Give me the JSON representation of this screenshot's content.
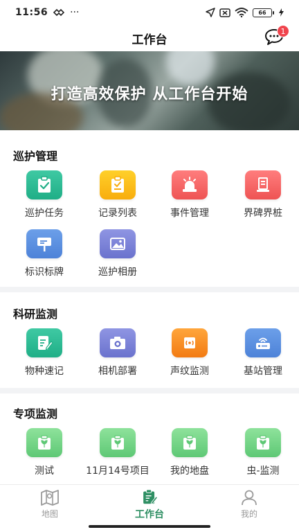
{
  "status_bar": {
    "time": "11:56",
    "dots": "···",
    "battery": "66"
  },
  "header": {
    "title": "工作台",
    "badge": "1"
  },
  "banner": {
    "text": "打造高效保护 从工作台开始"
  },
  "sections": [
    {
      "title": "巡护管理",
      "items": [
        {
          "label": "巡护任务",
          "icon": "clipboard-check-icon",
          "color": "#1fae86"
        },
        {
          "label": "记录列表",
          "icon": "clipboard-list-icon",
          "color": "#f8ad0d"
        },
        {
          "label": "事件管理",
          "icon": "alarm-light-icon",
          "color": "#ee5454"
        },
        {
          "label": "界碑界桩",
          "icon": "boundary-marker-icon",
          "color": "#ee5454"
        },
        {
          "label": "标识标牌",
          "icon": "signboard-icon",
          "color": "#4d82d8"
        },
        {
          "label": "巡护相册",
          "icon": "photo-album-icon",
          "color": "#6a72cd"
        }
      ]
    },
    {
      "title": "科研监测",
      "items": [
        {
          "label": "物种速记",
          "icon": "notepad-edit-icon",
          "color": "#1fae86"
        },
        {
          "label": "相机部署",
          "icon": "camera-icon",
          "color": "#6a72cd"
        },
        {
          "label": "声纹监测",
          "icon": "sound-sensor-icon",
          "color": "#f27a12"
        },
        {
          "label": "基站管理",
          "icon": "base-station-icon",
          "color": "#4d82d8"
        }
      ]
    },
    {
      "title": "专项监测",
      "items": [
        {
          "label": "测试",
          "icon": "plant-monitor-icon",
          "color": "#5ec875"
        },
        {
          "label": "11月14号项目",
          "icon": "plant-monitor-icon",
          "color": "#5ec875"
        },
        {
          "label": "我的地盘",
          "icon": "plant-monitor-icon",
          "color": "#5ec875"
        },
        {
          "label": "虫-监测",
          "icon": "plant-monitor-icon",
          "color": "#5ec875"
        }
      ]
    }
  ],
  "tabbar": {
    "tabs": [
      {
        "label": "地图",
        "icon": "map-icon",
        "active": false
      },
      {
        "label": "工作台",
        "icon": "workbench-icon",
        "active": true
      },
      {
        "label": "我的",
        "icon": "user-icon",
        "active": false
      }
    ]
  },
  "colors": {
    "accent": "#2e8f63",
    "badge": "#f0444d"
  }
}
